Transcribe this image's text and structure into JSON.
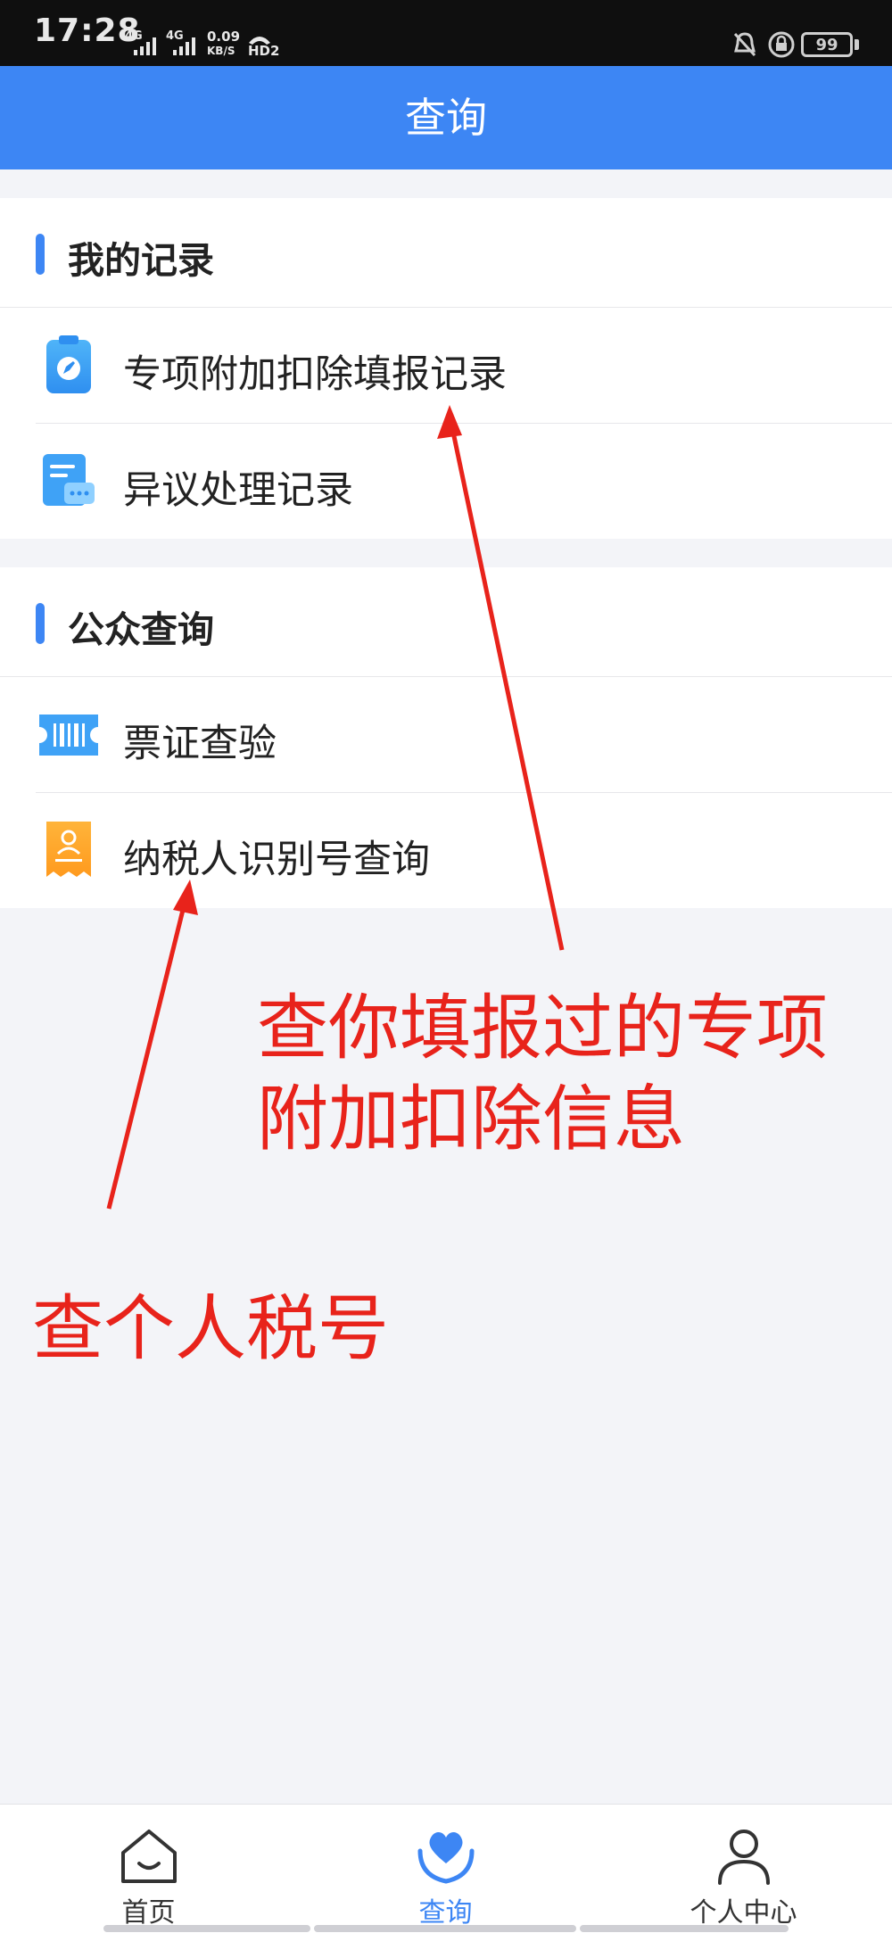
{
  "status_bar": {
    "time": "17:28",
    "network_1": "4G",
    "network_2": "4G",
    "speed_value": "0.09",
    "speed_unit": "KB/S",
    "hd_label": "HD2",
    "battery": "99"
  },
  "header": {
    "title": "查询"
  },
  "sections": [
    {
      "title": "我的记录",
      "items": [
        {
          "label": "专项附加扣除填报记录",
          "icon": "clipboard-edit-icon"
        },
        {
          "label": "异议处理记录",
          "icon": "document-chat-icon"
        }
      ]
    },
    {
      "title": "公众查询",
      "items": [
        {
          "label": "票证查验",
          "icon": "ticket-barcode-icon"
        },
        {
          "label": "纳税人识别号查询",
          "icon": "id-card-person-icon"
        }
      ]
    }
  ],
  "annotations": {
    "deduction_note_line1": "查你填报过的专项",
    "deduction_note_line2": "附加扣除信息",
    "taxid_note": "查个人税号"
  },
  "tabbar": {
    "tabs": [
      {
        "label": "首页",
        "icon": "home-icon"
      },
      {
        "label": "查询",
        "icon": "heart-hands-icon",
        "active": true
      },
      {
        "label": "个人中心",
        "icon": "person-icon"
      }
    ]
  },
  "colors": {
    "primary": "#3d86f4",
    "annotation": "#e8231b",
    "background": "#f3f4f8"
  }
}
